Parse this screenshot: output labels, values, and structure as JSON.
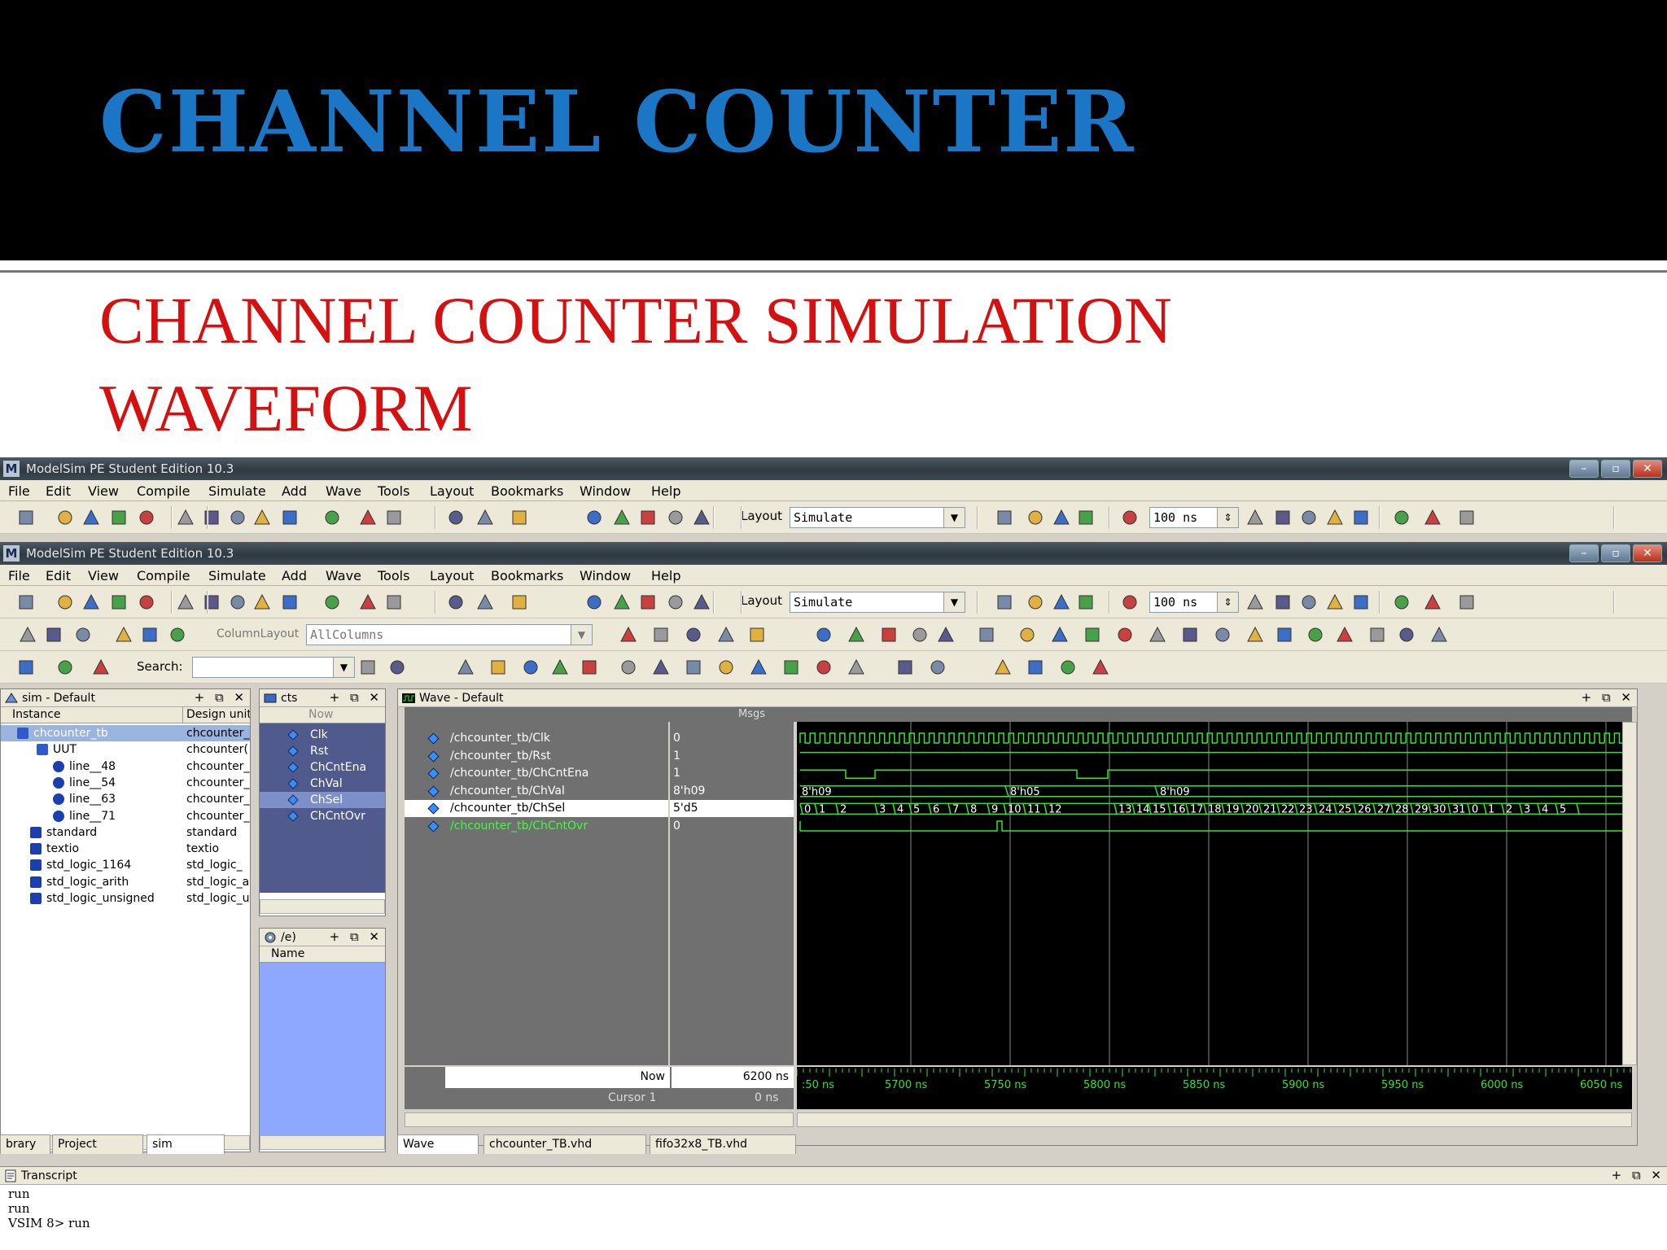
{
  "slide": {
    "title": "CHANNEL COUNTER",
    "subtitle_line1": "CHANNEL COUNTER SIMULATION",
    "subtitle_line2": "WAVEFORM"
  },
  "windows": [
    {
      "title": "ModelSim PE Student Edition 10.3"
    },
    {
      "title": "ModelSim PE Student Edition 10.3"
    }
  ],
  "menu": [
    "File",
    "Edit",
    "View",
    "Compile",
    "Simulate",
    "Add",
    "Wave",
    "Tools",
    "Layout",
    "Bookmarks",
    "Window",
    "Help"
  ],
  "toolbar": {
    "layout_label": "Layout",
    "layout_value": "Simulate",
    "run_length": "100 ns",
    "column_layout_label": "ColumnLayout",
    "column_layout_value": "AllColumns",
    "search_label": "Search:",
    "search_value": ""
  },
  "sim_panel": {
    "title": "sim - Default",
    "columns": [
      "Instance",
      "Design unit"
    ],
    "rows": [
      {
        "instance": "chcounter_tb",
        "unit": "chcounter_"
      },
      {
        "instance": "UUT",
        "unit": "chcounter("
      },
      {
        "instance": "line__48",
        "unit": "chcounter_"
      },
      {
        "instance": "line__54",
        "unit": "chcounter_"
      },
      {
        "instance": "line__63",
        "unit": "chcounter_"
      },
      {
        "instance": "line__71",
        "unit": "chcounter_"
      },
      {
        "instance": "standard",
        "unit": "standard"
      },
      {
        "instance": "textio",
        "unit": "textio"
      },
      {
        "instance": "std_logic_1164",
        "unit": "std_logic_"
      },
      {
        "instance": "std_logic_arith",
        "unit": "std_logic_a"
      },
      {
        "instance": "std_logic_unsigned",
        "unit": "std_logic_u"
      }
    ]
  },
  "objects_panel": {
    "title": "cts",
    "now_label": "Now",
    "items": [
      "Clk",
      "Rst",
      "ChCntEna",
      "ChVal",
      "ChSel",
      "ChCntOvr"
    ]
  },
  "process_panel": {
    "title": "/e)",
    "column": "Name"
  },
  "left_tabs": [
    "brary",
    "Project",
    "sim"
  ],
  "wave": {
    "title": "Wave - Default",
    "msgs_label": "Msgs",
    "signals": [
      {
        "name": "/chcounter_tb/Clk",
        "value": "0"
      },
      {
        "name": "/chcounter_tb/Rst",
        "value": "1"
      },
      {
        "name": "/chcounter_tb/ChCntEna",
        "value": "1"
      },
      {
        "name": "/chcounter_tb/ChVal",
        "value": "8'h09"
      },
      {
        "name": "/chcounter_tb/ChSel",
        "value": "5'd5"
      },
      {
        "name": "/chcounter_tb/ChCntOvr",
        "value": "0"
      }
    ],
    "chval_labels": [
      "8'h09",
      "8'h05",
      "8'h09"
    ],
    "chsel_labels": [
      "0",
      "1",
      "2",
      "3",
      "4",
      "5",
      "6",
      "7",
      "8",
      "9",
      "10",
      "11",
      "12",
      "13",
      "14",
      "15",
      "16",
      "17",
      "18",
      "19",
      "20",
      "21",
      "22",
      "23",
      "24",
      "25",
      "26",
      "27",
      "28",
      "29",
      "30",
      "31",
      "0",
      "1",
      "2",
      "3",
      "4",
      "5"
    ],
    "now_label": "Now",
    "now_value": "6200 ns",
    "cursor_label": "Cursor 1",
    "cursor_value": "0 ns",
    "time_ticks": [
      ":50 ns",
      "5700 ns",
      "5750 ns",
      "5800 ns",
      "5850 ns",
      "5900 ns",
      "5950 ns",
      "6000 ns",
      "6050 ns"
    ]
  },
  "bottom_tabs": [
    "Wave",
    "chcounter_TB.vhd",
    "fifo32x8_TB.vhd"
  ],
  "transcript": {
    "title": "Transcript",
    "lines": [
      "run",
      "run",
      "VSIM 8> run"
    ]
  },
  "colors": {
    "title_blue": "#1b76c5",
    "subtitle_red": "#d51010",
    "wave_green": "#2ee82e",
    "wave_bg": "#000000"
  }
}
